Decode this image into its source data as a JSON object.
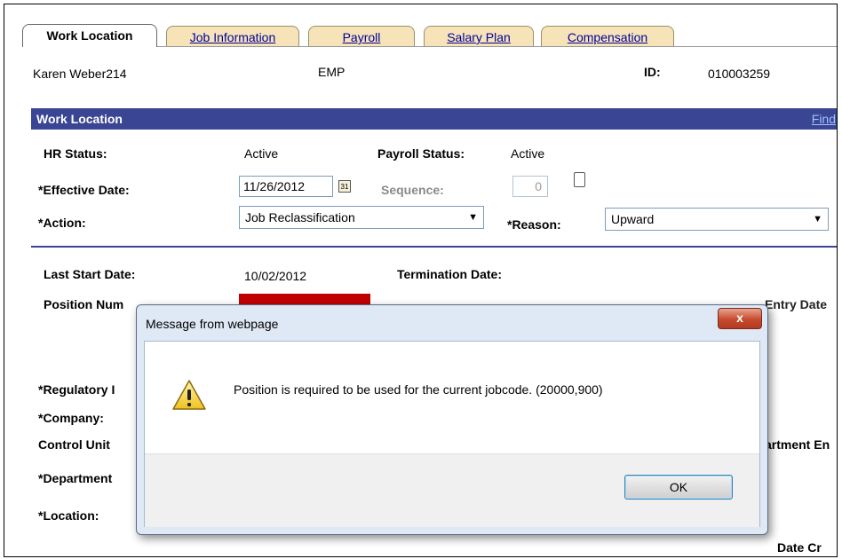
{
  "tabs": [
    {
      "label": "Work Location",
      "active": true
    },
    {
      "label": "Job Information",
      "active": false
    },
    {
      "label": "Payroll",
      "active": false
    },
    {
      "label": "Salary Plan",
      "active": false
    },
    {
      "label": "Compensation",
      "active": false
    }
  ],
  "employee": {
    "name": "Karen Weber214",
    "type": "EMP",
    "id_label": "ID:",
    "id_value": "010003259"
  },
  "section": {
    "title": "Work Location",
    "find_link": "Find"
  },
  "fields": {
    "hr_status_label": "HR Status:",
    "hr_status_value": "Active",
    "payroll_status_label": "Payroll Status:",
    "payroll_status_value": "Active",
    "effective_date_label": "*Effective Date:",
    "effective_date_value": "11/26/2012",
    "sequence_label": "Sequence:",
    "sequence_value": "0",
    "action_label": "*Action:",
    "action_value": "Job Reclassification",
    "reason_label": "*Reason:",
    "reason_value": "Upward",
    "last_start_label": "Last Start Date:",
    "last_start_value": "10/02/2012",
    "termination_label": "Termination Date:",
    "position_number_label": "Position Num",
    "position_entry_label": "Entry Date",
    "regulatory_label": "*Regulatory I",
    "company_label": "*Company:",
    "control_unit_label": "Control Unit",
    "department_label": "*Department",
    "department_entry_label": "artment En",
    "location_label": "*Location:",
    "date_created_label": "Date Cr"
  },
  "dialog": {
    "title": "Message from webpage",
    "close_symbol": "x",
    "message": "Position is required to be used for the current jobcode. (20000,900)",
    "ok_label": "OK"
  },
  "colors": {
    "section_header": "#3a4593",
    "tab_inactive": "#f6e3b8",
    "link": "#00009c",
    "error_field": "#c00000"
  }
}
